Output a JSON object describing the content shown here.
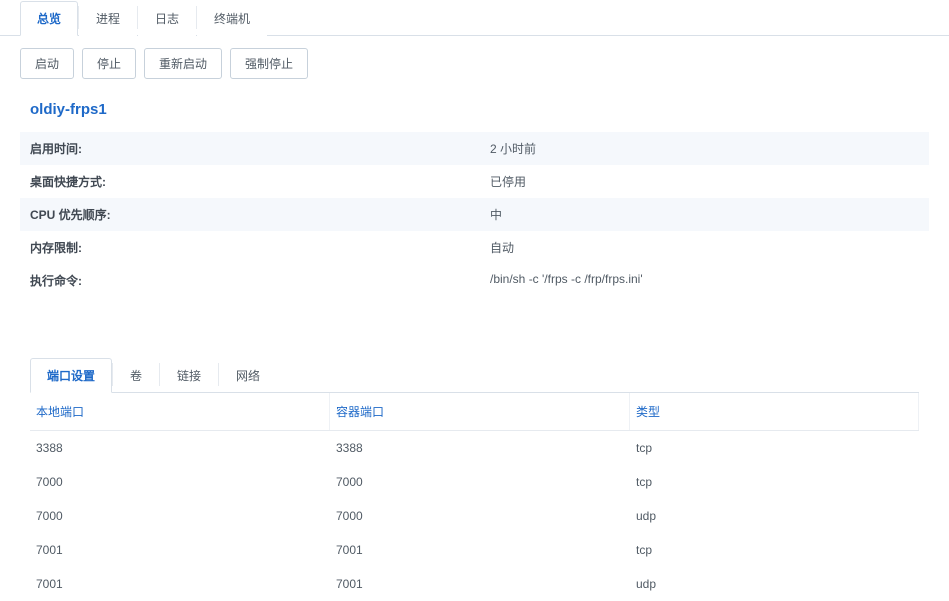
{
  "mainTabs": {
    "overview": "总览",
    "process": "进程",
    "log": "日志",
    "terminal": "终端机"
  },
  "toolbar": {
    "start": "启动",
    "stop": "停止",
    "restart": "重新启动",
    "forceStop": "强制停止"
  },
  "container": {
    "title": "oldiy-frps1",
    "rows": {
      "uptime_label": "启用时间:",
      "uptime_value": "2 小时前",
      "shortcut_label": "桌面快捷方式:",
      "shortcut_value": "已停用",
      "cpu_label": "CPU 优先顺序:",
      "cpu_value": "中",
      "memory_label": "内存限制:",
      "memory_value": "自动",
      "cmd_label": "执行命令:",
      "cmd_value": "/bin/sh -c '/frps -c /frp/frps.ini'"
    }
  },
  "subTabs": {
    "port": "端口设置",
    "volume": "卷",
    "link": "链接",
    "network": "网络"
  },
  "portTable": {
    "headers": {
      "local": "本地端口",
      "container": "容器端口",
      "type": "类型"
    },
    "rows": [
      {
        "local": "3388",
        "container": "3388",
        "type": "tcp"
      },
      {
        "local": "7000",
        "container": "7000",
        "type": "tcp"
      },
      {
        "local": "7000",
        "container": "7000",
        "type": "udp"
      },
      {
        "local": "7001",
        "container": "7001",
        "type": "tcp"
      },
      {
        "local": "7001",
        "container": "7001",
        "type": "udp"
      }
    ]
  }
}
